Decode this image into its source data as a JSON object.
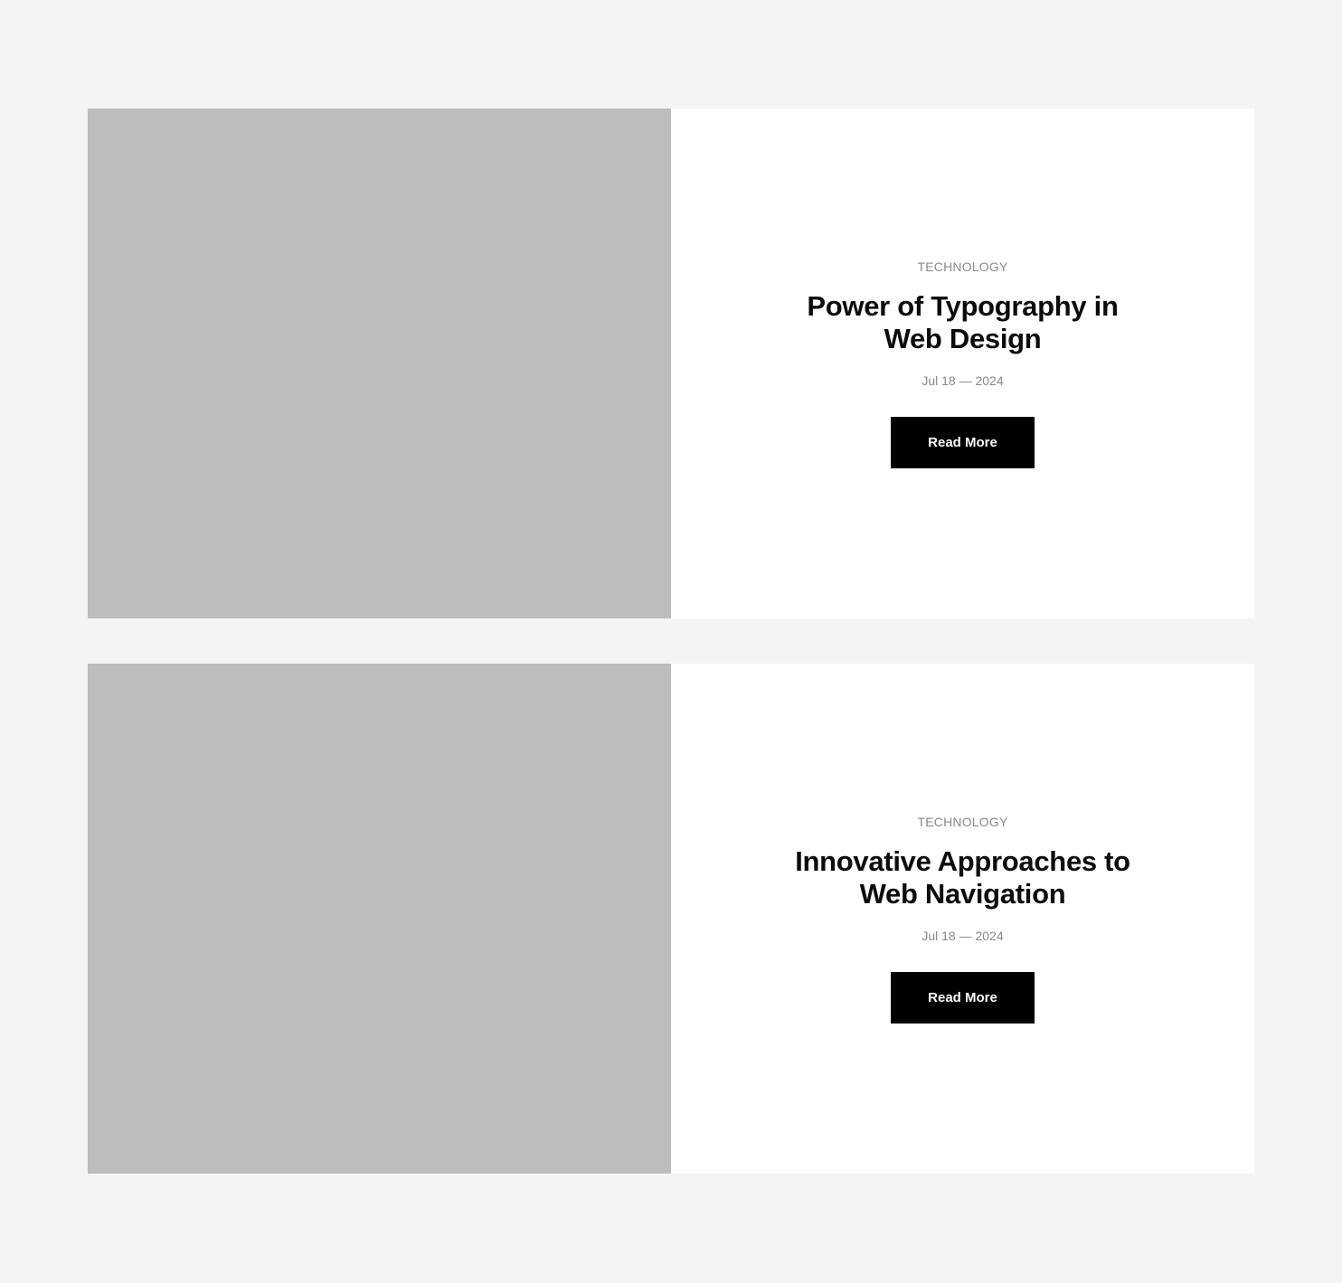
{
  "posts": [
    {
      "category": "TECHNOLOGY",
      "title": "Power of Typography in Web Design",
      "date": "Jul 18 — 2024",
      "button_label": "Read More"
    },
    {
      "category": "TECHNOLOGY",
      "title": "Innovative Approaches to Web Navigation",
      "date": "Jul 18 — 2024",
      "button_label": "Read More"
    }
  ],
  "colors": {
    "page_background": "#f4f4f4",
    "image_placeholder": "#bcbdbf",
    "button_background": "#000000",
    "muted_text": "#8a8a8a"
  }
}
